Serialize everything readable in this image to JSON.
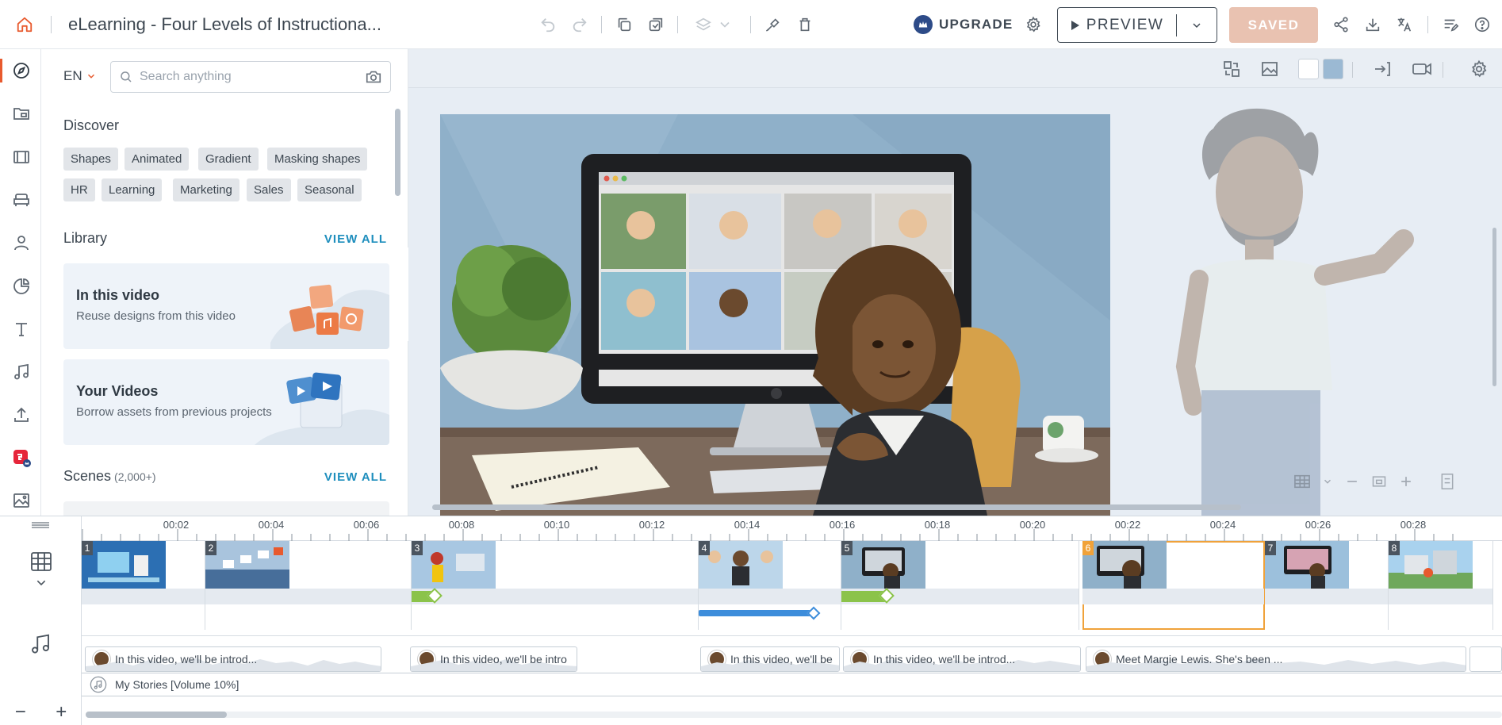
{
  "app": {
    "title": "eLearning - Four Levels of Instructiona...",
    "upgrade_label": "UPGRADE",
    "preview_label": "PREVIEW",
    "saved_label": "SAVED",
    "accent_color": "#e85a2e",
    "link_color": "#1e8ebd"
  },
  "toolbar_icons": [
    "home-icon",
    "undo-icon",
    "redo-icon",
    "copy-icon",
    "duplicate-icon",
    "layers-icon",
    "chevron-down-icon",
    "paint-icon",
    "trash-icon",
    "gear-icon",
    "share-icon",
    "download-icon",
    "translate-icon",
    "script-icon",
    "help-icon"
  ],
  "rail_icons": [
    "compass-icon",
    "folder-icon",
    "film-icon",
    "couch-icon",
    "person-icon",
    "chart-icon",
    "text-icon",
    "music-icon",
    "upload-icon",
    "brand-icon",
    "image-icon"
  ],
  "panel": {
    "language": "EN",
    "search_placeholder": "Search anything",
    "discover_title": "Discover",
    "chips": [
      "Shapes",
      "Animated",
      "Gradient",
      "Masking shapes",
      "HR",
      "Learning",
      "Marketing",
      "Sales",
      "Seasonal"
    ],
    "library_title": "Library",
    "view_all": "VIEW ALL",
    "cards": [
      {
        "title": "In this video",
        "subtitle": "Reuse designs from this video"
      },
      {
        "title": "Your Videos",
        "subtitle": "Borrow assets from previous projects"
      }
    ],
    "scenes_title": "Scenes",
    "scenes_count": "(2,000+)"
  },
  "timeline": {
    "ticks": [
      "00:02",
      "00:04",
      "00:06",
      "00:08",
      "00:10",
      "00:12",
      "00:14",
      "00:16",
      "00:18",
      "00:20",
      "00:22",
      "00:24",
      "00:26",
      "00:28"
    ],
    "scenes": [
      "1",
      "2",
      "3",
      "4",
      "5",
      "6",
      "7",
      "8"
    ],
    "active_scene": "6",
    "voice_clips": [
      "In this video, we'll be introd...",
      "In this video, we'll be intro",
      "In this video, we'll be",
      "In this video, we'll be introd...",
      "Meet Margie Lewis. She's been ..."
    ],
    "music_label": "My Stories [Volume 10%]",
    "zoom_out": "−",
    "zoom_in": "+"
  }
}
